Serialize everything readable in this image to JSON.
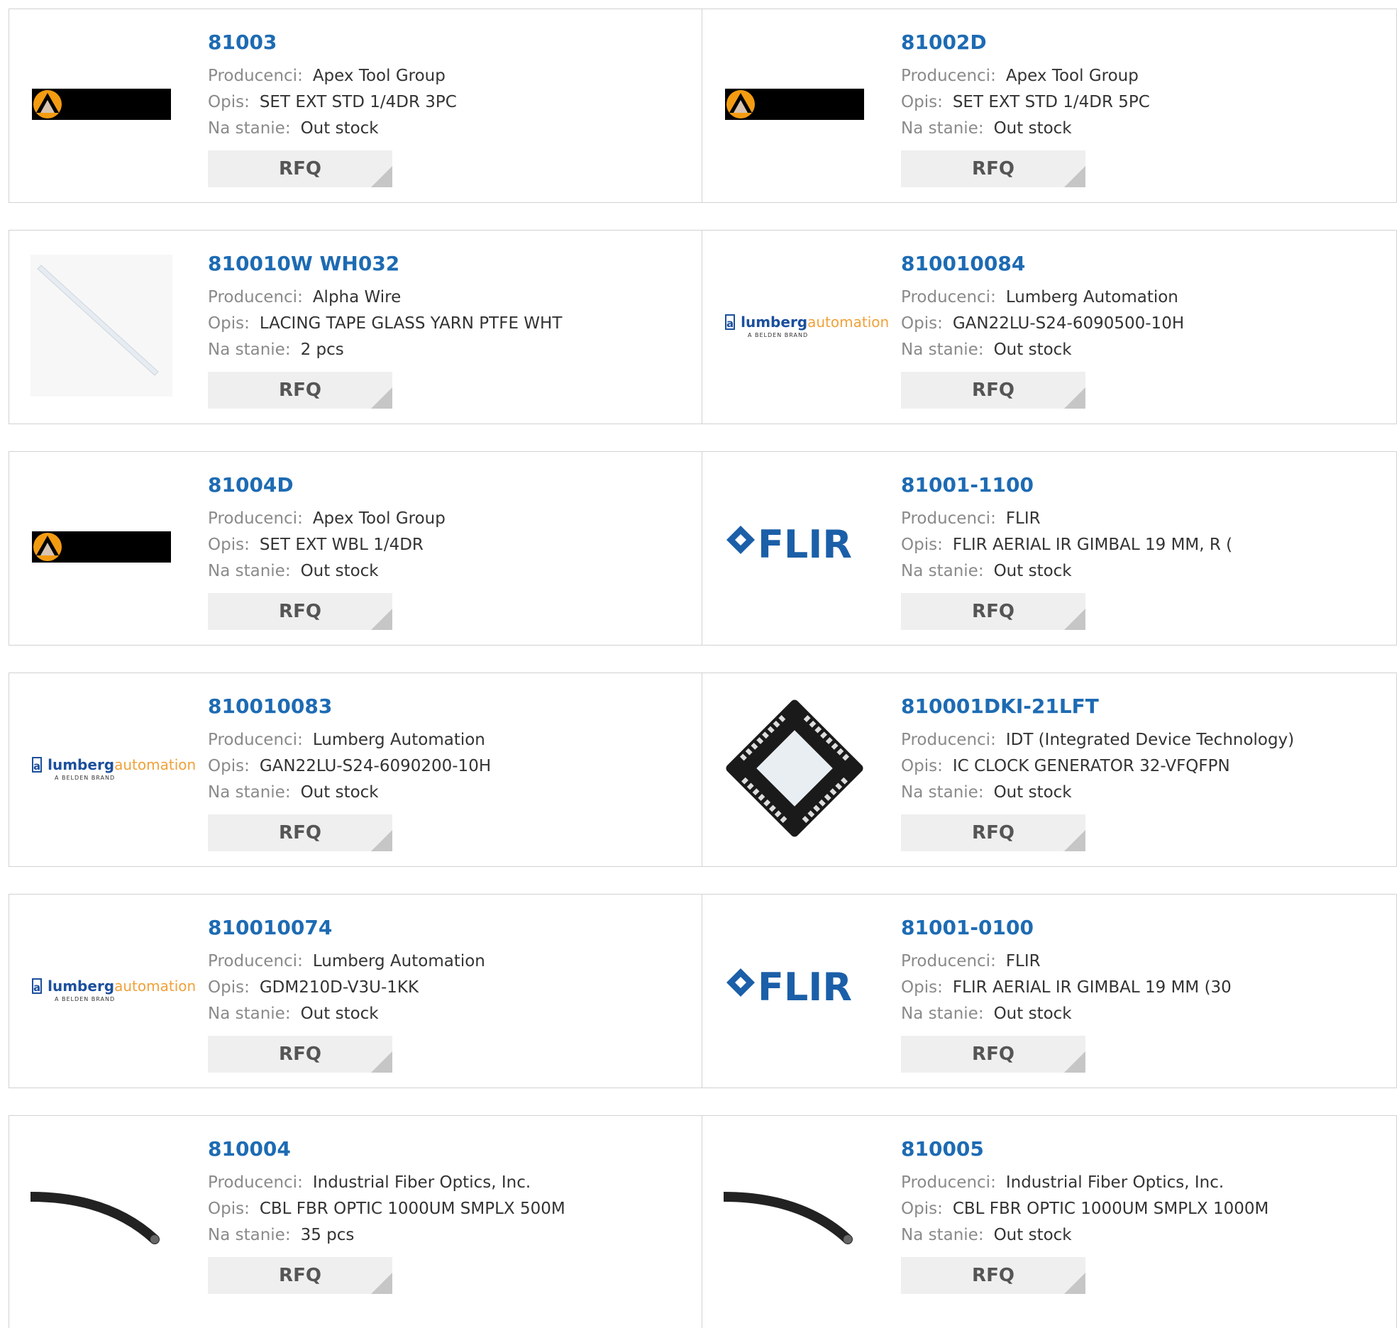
{
  "labels": {
    "manufacturer": "Producenci:",
    "description": "Opis:",
    "stock": "Na stanie:",
    "rfq": "RFQ"
  },
  "colors": {
    "link": "#1d6bb3",
    "label": "#8a8a8a",
    "button_bg": "#efefef"
  },
  "products": [
    {
      "part": "81003",
      "manufacturer": "Apex Tool Group",
      "description": "SET EXT STD 1/4DR 3PC",
      "stock": "Out stock",
      "image": "apex-logo"
    },
    {
      "part": "81002D",
      "manufacturer": "Apex Tool Group",
      "description": "SET EXT STD 1/4DR 5PC",
      "stock": "Out stock",
      "image": "apex-logo"
    },
    {
      "part": "810010W WH032",
      "manufacturer": "Alpha Wire",
      "description": "LACING TAPE GLASS YARN PTFE WHT",
      "stock": "2 pcs",
      "image": "lacing-tape"
    },
    {
      "part": "810010084",
      "manufacturer": "Lumberg Automation",
      "description": "GAN22LU-S24-6090500-10H",
      "stock": "Out stock",
      "image": "lumberg-logo"
    },
    {
      "part": "81004D",
      "manufacturer": "Apex Tool Group",
      "description": "SET EXT WBL 1/4DR",
      "stock": "Out stock",
      "image": "apex-logo"
    },
    {
      "part": "81001-1100",
      "manufacturer": "FLIR",
      "description": "FLIR AERIAL IR GIMBAL 19 MM, R (",
      "stock": "Out stock",
      "image": "flir-logo"
    },
    {
      "part": "810010083",
      "manufacturer": "Lumberg Automation",
      "description": "GAN22LU-S24-6090200-10H",
      "stock": "Out stock",
      "image": "lumberg-logo"
    },
    {
      "part": "810001DKI-21LFT",
      "manufacturer": "IDT (Integrated Device Technology)",
      "description": "IC CLOCK GENERATOR 32-VFQFPN",
      "stock": "Out stock",
      "image": "qfn-chip"
    },
    {
      "part": "810010074",
      "manufacturer": "Lumberg Automation",
      "description": "GDM210D-V3U-1KK",
      "stock": "Out stock",
      "image": "lumberg-logo"
    },
    {
      "part": "81001-0100",
      "manufacturer": "FLIR",
      "description": "FLIR AERIAL IR GIMBAL 19 MM (30",
      "stock": "Out stock",
      "image": "flir-logo"
    },
    {
      "part": "810004",
      "manufacturer": "Industrial Fiber Optics, Inc.",
      "description": "CBL FBR OPTIC 1000UM SMPLX 500M",
      "stock": "35 pcs",
      "image": "fiber-cable"
    },
    {
      "part": "810005",
      "manufacturer": "Industrial Fiber Optics, Inc.",
      "description": "CBL FBR OPTIC 1000UM SMPLX 1000M",
      "stock": "Out stock",
      "image": "fiber-cable"
    }
  ],
  "logos": {
    "lumberg_a": "lumberg",
    "lumberg_b": "automation",
    "lumberg_tag": "A BELDEN BRAND",
    "flir": "FLIR"
  }
}
